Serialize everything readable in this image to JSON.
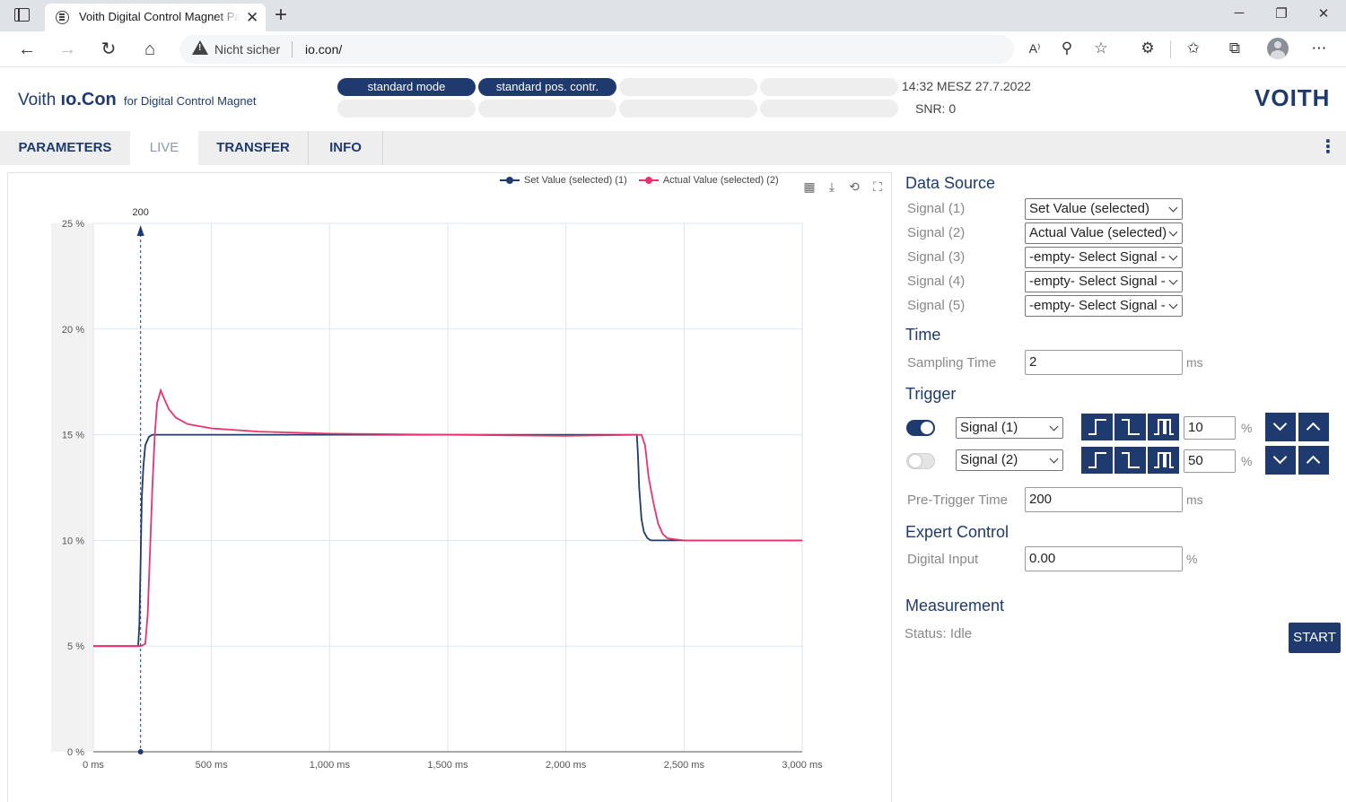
{
  "browser": {
    "tab_title": "Voith Digital Control Magnet Parameter",
    "address_security": "Nicht sicher",
    "address_url": "io.con/"
  },
  "header": {
    "brand_name": "Voith",
    "brand_product": "ıo.Con",
    "brand_tagline": "for Digital Control Magnet",
    "mode_pills": [
      "standard mode",
      "standard pos. contr.",
      "",
      "",
      "",
      "",
      "",
      ""
    ],
    "time": "14:32 MESZ 27.7.2022",
    "snr": "SNR: 0",
    "logo": "VOITH"
  },
  "nav": {
    "tabs": [
      {
        "label": "PARAMETERS",
        "active": false
      },
      {
        "label": "LIVE",
        "active": true
      },
      {
        "label": "TRANSFER",
        "active": false
      },
      {
        "label": "INFO",
        "active": false
      }
    ]
  },
  "chart_legend": {
    "series1": "Set Value (selected) (1)",
    "series2": "Actual Value (selected) (2)"
  },
  "chart_data": {
    "type": "line",
    "x_unit": "ms",
    "y_unit": "%",
    "xlim": [
      0,
      3000
    ],
    "ylim": [
      0,
      25
    ],
    "x_ticks": [
      0,
      500,
      1000,
      1500,
      2000,
      2500,
      3000
    ],
    "x_tick_labels": [
      "0 ms",
      "500 ms",
      "1,000 ms",
      "1,500 ms",
      "2,000 ms",
      "2,500 ms",
      "3,000 ms"
    ],
    "y_ticks": [
      0,
      5,
      10,
      15,
      20,
      25
    ],
    "y_tick_labels": [
      "0 %",
      "5 %",
      "10 %",
      "15 %",
      "20 %",
      "25 %"
    ],
    "grid": true,
    "legend_position": "top-right",
    "trigger_marker": {
      "x": 200,
      "label": "200"
    },
    "series": [
      {
        "name": "Set Value (selected) (1)",
        "color": "#1e3a6e",
        "x": [
          0,
          180,
          190,
          195,
          200,
          205,
          212,
          220,
          235,
          250,
          300,
          600,
          1000,
          1500,
          2000,
          2290,
          2300,
          2305,
          2310,
          2320,
          2330,
          2345,
          2360,
          2400,
          2500,
          3000
        ],
        "y": [
          5.0,
          5.0,
          5.0,
          6.0,
          9.0,
          12.0,
          13.5,
          14.5,
          14.9,
          15.0,
          15.0,
          15.0,
          15.0,
          15.0,
          15.0,
          15.0,
          15.0,
          14.0,
          12.5,
          11.0,
          10.4,
          10.1,
          10.0,
          10.0,
          10.0,
          10.0
        ]
      },
      {
        "name": "Actual Value (selected) (2)",
        "color": "#e8336d",
        "x": [
          0,
          200,
          220,
          230,
          240,
          250,
          260,
          270,
          285,
          300,
          320,
          350,
          400,
          500,
          700,
          1000,
          1500,
          2000,
          2320,
          2335,
          2350,
          2370,
          2390,
          2410,
          2430,
          2460,
          2500,
          2600,
          3000
        ],
        "y": [
          5.0,
          5.0,
          5.1,
          6.5,
          9.5,
          12.5,
          15.0,
          16.5,
          17.1,
          16.7,
          16.2,
          15.8,
          15.5,
          15.3,
          15.15,
          15.05,
          15.0,
          14.95,
          15.0,
          14.5,
          13.0,
          11.8,
          10.8,
          10.3,
          10.1,
          10.05,
          10.0,
          10.0,
          10.0
        ]
      }
    ]
  },
  "settings": {
    "data_source": {
      "title": "Data Source",
      "signals": [
        {
          "label": "Signal (1)",
          "value": "Set Value (selected)"
        },
        {
          "label": "Signal (2)",
          "value": "Actual Value (selected)"
        },
        {
          "label": "Signal (3)",
          "value": "-empty- Select Signal -"
        },
        {
          "label": "Signal (4)",
          "value": "-empty- Select Signal -"
        },
        {
          "label": "Signal (5)",
          "value": "-empty- Select Signal -"
        }
      ]
    },
    "time": {
      "title": "Time",
      "sampling_label": "Sampling Time",
      "sampling_value": "2",
      "sampling_unit": "ms"
    },
    "trigger": {
      "title": "Trigger",
      "rows": [
        {
          "enabled": true,
          "signal": "Signal (1)",
          "level": "10",
          "unit": "%"
        },
        {
          "enabled": false,
          "signal": "Signal (2)",
          "level": "50",
          "unit": "%"
        }
      ],
      "pretrigger_label": "Pre-Trigger Time",
      "pretrigger_value": "200",
      "pretrigger_unit": "ms"
    },
    "expert": {
      "title": "Expert Control",
      "digital_label": "Digital Input",
      "digital_value": "0.00",
      "digital_unit": "%"
    },
    "measurement": {
      "title": "Measurement",
      "status": "Status: Idle",
      "start_label": "START"
    }
  }
}
